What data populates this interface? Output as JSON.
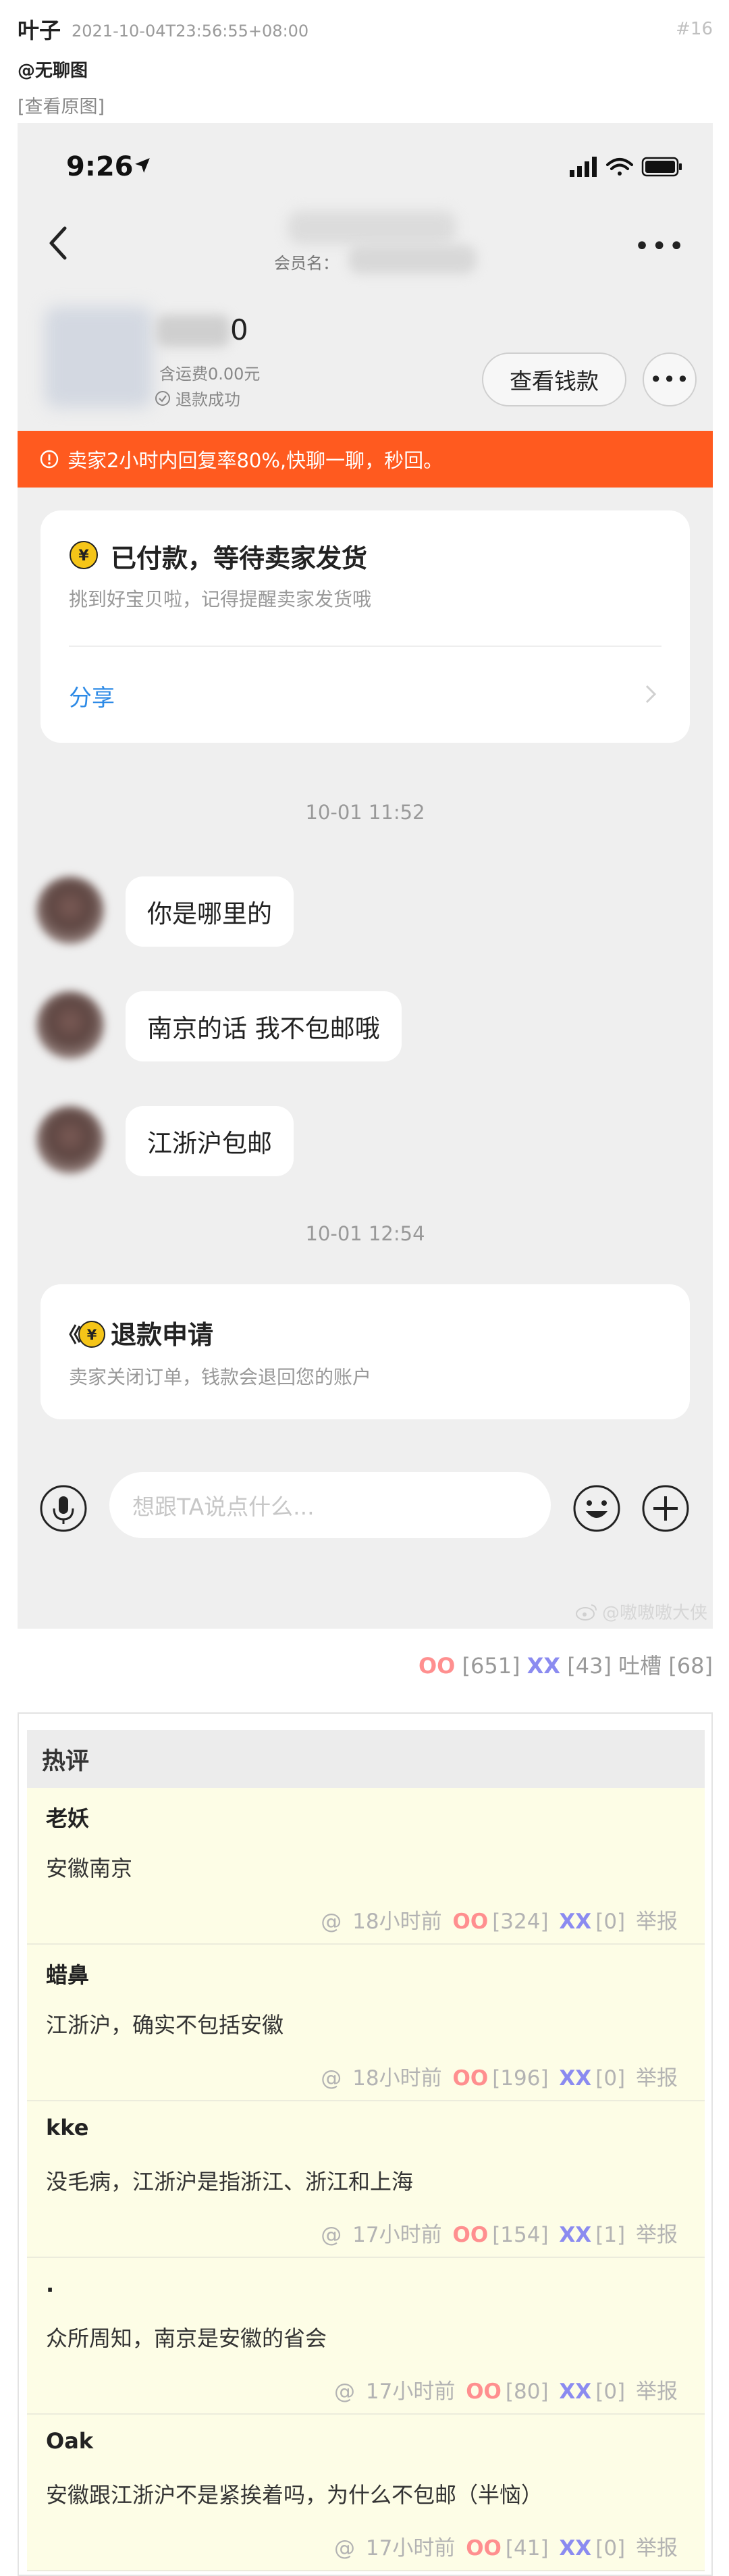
{
  "post": {
    "author": "叶子",
    "time": "2021-10-04T23:56:55+08:00",
    "number": "#16",
    "mention": "@无聊图",
    "view_original": "[查看原图]"
  },
  "screenshot": {
    "status_time": "9:26",
    "nav": {
      "member_label": "会员名：",
      "more": "•••"
    },
    "order": {
      "price_tail": "0",
      "shipping": "含运费0.00元",
      "refund_status": "退款成功",
      "wallet_button": "查看钱款",
      "more_button": "•••"
    },
    "notice": "卖家2小时内回复率80%,快聊一聊，秒回。",
    "paid_card": {
      "title": "已付款，等待卖家发货",
      "subtitle": "挑到好宝贝啦，记得提醒卖家发货哦",
      "share": "分享"
    },
    "chat": {
      "time1": "10-01 11:52",
      "messages": [
        "你是哪里的",
        "南京的话 我不包邮哦",
        "江浙沪包邮"
      ],
      "time2": "10-01 12:54"
    },
    "refund_card": {
      "title": "退款申请",
      "subtitle": "卖家关闭订单，钱款会退回您的账户"
    },
    "input_placeholder": "想跟TA说点什么...",
    "watermark": "@嗷嗷嗷大侠"
  },
  "votes": {
    "oo_label": "OO",
    "oo_count": "[651]",
    "xx_label": "XX",
    "xx_count": "[43]",
    "tucao_label": "吐槽",
    "tucao_count": "[68]"
  },
  "hot_comments": {
    "header": "热评",
    "items": [
      {
        "author": "老妖",
        "text": "安徽南京",
        "at": "@",
        "time": "18小时前",
        "oo": "OO",
        "oo_count": "[324]",
        "xx": "XX",
        "xx_count": "[0]",
        "report": "举报"
      },
      {
        "author": "蜡鼻",
        "text": "江浙沪，确实不包括安徽",
        "at": "@",
        "time": "18小时前",
        "oo": "OO",
        "oo_count": "[196]",
        "xx": "XX",
        "xx_count": "[0]",
        "report": "举报"
      },
      {
        "author": "kke",
        "text": "没毛病，江浙沪是指浙江、浙江和上海",
        "at": "@",
        "time": "17小时前",
        "oo": "OO",
        "oo_count": "[154]",
        "xx": "XX",
        "xx_count": "[1]",
        "report": "举报"
      },
      {
        "author": ".",
        "text": "众所周知，南京是安徽的省会",
        "at": "@",
        "time": "17小时前",
        "oo": "OO",
        "oo_count": "[80]",
        "xx": "XX",
        "xx_count": "[0]",
        "report": "举报"
      },
      {
        "author": "Oak",
        "text": "安徽跟江浙沪不是紧挨着吗，为什么不包邮（半恼）",
        "at": "@",
        "time": "17小时前",
        "oo": "OO",
        "oo_count": "[41]",
        "xx": "XX",
        "xx_count": "[0]",
        "report": "举报"
      }
    ]
  },
  "colors": {
    "notice_bg": "#ff5a1f",
    "link_blue": "#2d8ae6",
    "oo_pink": "#ff8f8f",
    "xx_purple": "#8b8bf0",
    "comment_bg": "#fdfde6",
    "coin_yellow": "#f5c518"
  },
  "icons": [
    "location-arrow-icon",
    "signal-icon",
    "wifi-icon",
    "battery-icon",
    "back-chevron-icon",
    "check-circle-icon",
    "warning-circle-icon",
    "yuan-coin-icon",
    "chevron-right-icon",
    "refund-coin-icon",
    "microphone-icon",
    "emoji-icon",
    "plus-circle-icon",
    "weibo-icon"
  ]
}
